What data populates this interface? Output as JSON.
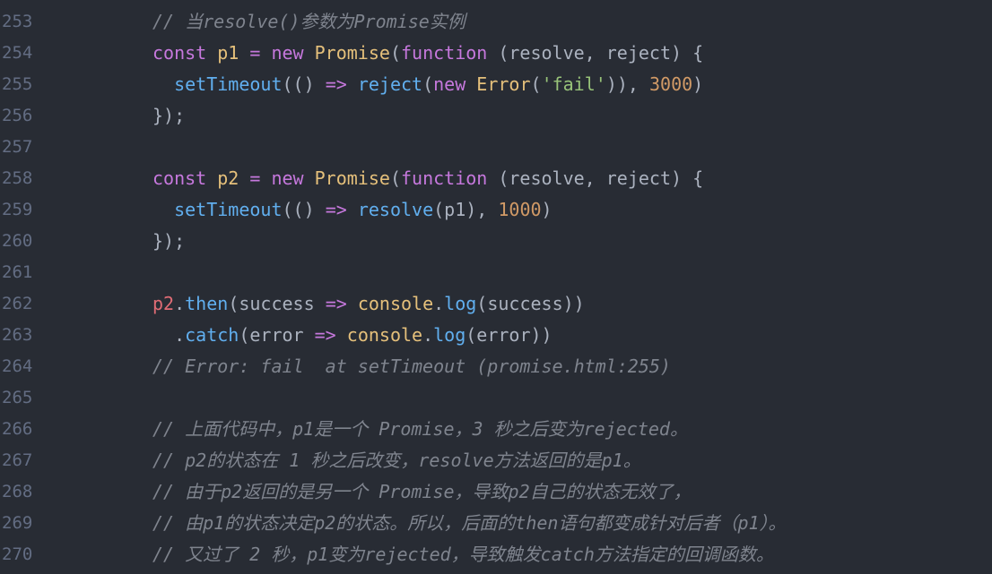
{
  "lines": [
    {
      "number": "253",
      "t": [
        {
          "text": "// 当resolve()参数为Promise实例",
          "cls": "cmt"
        }
      ]
    },
    {
      "number": "254",
      "t": [
        {
          "text": "const ",
          "cls": "kw"
        },
        {
          "text": "p1",
          "cls": "var"
        },
        {
          "text": " = ",
          "cls": "op"
        },
        {
          "text": "new ",
          "cls": "kw"
        },
        {
          "text": "Promise",
          "cls": "cls"
        },
        {
          "text": "(",
          "cls": "pl"
        },
        {
          "text": "function",
          "cls": "kw"
        },
        {
          "text": " (resolve, reject) {",
          "cls": "pl"
        }
      ]
    },
    {
      "number": "255",
      "t": [
        {
          "text": "  ",
          "cls": "pl"
        },
        {
          "text": "setTimeout",
          "cls": "fn"
        },
        {
          "text": "(() ",
          "cls": "pl"
        },
        {
          "text": "=>",
          "cls": "op"
        },
        {
          "text": " ",
          "cls": "pl"
        },
        {
          "text": "reject",
          "cls": "fn"
        },
        {
          "text": "(",
          "cls": "pl"
        },
        {
          "text": "new ",
          "cls": "kw"
        },
        {
          "text": "Error",
          "cls": "cls"
        },
        {
          "text": "(",
          "cls": "pl"
        },
        {
          "text": "'fail'",
          "cls": "str"
        },
        {
          "text": ")), ",
          "cls": "pl"
        },
        {
          "text": "3000",
          "cls": "num"
        },
        {
          "text": ")",
          "cls": "pl"
        }
      ]
    },
    {
      "number": "256",
      "t": [
        {
          "text": "});",
          "cls": "pl"
        }
      ]
    },
    {
      "number": "257",
      "t": []
    },
    {
      "number": "258",
      "t": [
        {
          "text": "const ",
          "cls": "kw"
        },
        {
          "text": "p2",
          "cls": "var"
        },
        {
          "text": " = ",
          "cls": "op"
        },
        {
          "text": "new ",
          "cls": "kw"
        },
        {
          "text": "Promise",
          "cls": "cls"
        },
        {
          "text": "(",
          "cls": "pl"
        },
        {
          "text": "function",
          "cls": "kw"
        },
        {
          "text": " (resolve, reject) {",
          "cls": "pl"
        }
      ]
    },
    {
      "number": "259",
      "t": [
        {
          "text": "  ",
          "cls": "pl"
        },
        {
          "text": "setTimeout",
          "cls": "fn"
        },
        {
          "text": "(() ",
          "cls": "pl"
        },
        {
          "text": "=>",
          "cls": "op"
        },
        {
          "text": " ",
          "cls": "pl"
        },
        {
          "text": "resolve",
          "cls": "fn"
        },
        {
          "text": "(p1), ",
          "cls": "pl"
        },
        {
          "text": "1000",
          "cls": "num"
        },
        {
          "text": ")",
          "cls": "pl"
        }
      ]
    },
    {
      "number": "260",
      "t": [
        {
          "text": "});",
          "cls": "pl"
        }
      ]
    },
    {
      "number": "261",
      "t": []
    },
    {
      "number": "262",
      "t": [
        {
          "text": "p2",
          "cls": "red"
        },
        {
          "text": ".",
          "cls": "pl"
        },
        {
          "text": "then",
          "cls": "fn"
        },
        {
          "text": "(success ",
          "cls": "pl"
        },
        {
          "text": "=>",
          "cls": "op"
        },
        {
          "text": " ",
          "cls": "pl"
        },
        {
          "text": "console",
          "cls": "cls"
        },
        {
          "text": ".",
          "cls": "pl"
        },
        {
          "text": "log",
          "cls": "fn"
        },
        {
          "text": "(success))",
          "cls": "pl"
        }
      ]
    },
    {
      "number": "263",
      "t": [
        {
          "text": "  .",
          "cls": "pl"
        },
        {
          "text": "catch",
          "cls": "fn"
        },
        {
          "text": "(error ",
          "cls": "pl"
        },
        {
          "text": "=>",
          "cls": "op"
        },
        {
          "text": " ",
          "cls": "pl"
        },
        {
          "text": "console",
          "cls": "cls"
        },
        {
          "text": ".",
          "cls": "pl"
        },
        {
          "text": "log",
          "cls": "fn"
        },
        {
          "text": "(error))",
          "cls": "pl"
        }
      ]
    },
    {
      "number": "264",
      "t": [
        {
          "text": "// Error: fail  at setTimeout (promise.html:255)",
          "cls": "cmt"
        }
      ]
    },
    {
      "number": "265",
      "t": []
    },
    {
      "number": "266",
      "t": [
        {
          "text": "// 上面代码中，p1是一个 Promise，3 秒之后变为rejected。",
          "cls": "cmt"
        }
      ]
    },
    {
      "number": "267",
      "t": [
        {
          "text": "// p2的状态在 1 秒之后改变，resolve方法返回的是p1。",
          "cls": "cmt"
        }
      ]
    },
    {
      "number": "268",
      "t": [
        {
          "text": "// 由于p2返回的是另一个 Promise，导致p2自己的状态无效了，",
          "cls": "cmt"
        }
      ]
    },
    {
      "number": "269",
      "t": [
        {
          "text": "// 由p1的状态决定p2的状态。所以，后面的then语句都变成针对后者（p1）。",
          "cls": "cmt"
        }
      ]
    },
    {
      "number": "270",
      "t": [
        {
          "text": "// 又过了 2 秒，p1变为rejected，导致触发catch方法指定的回调函数。",
          "cls": "cmt"
        }
      ]
    }
  ]
}
